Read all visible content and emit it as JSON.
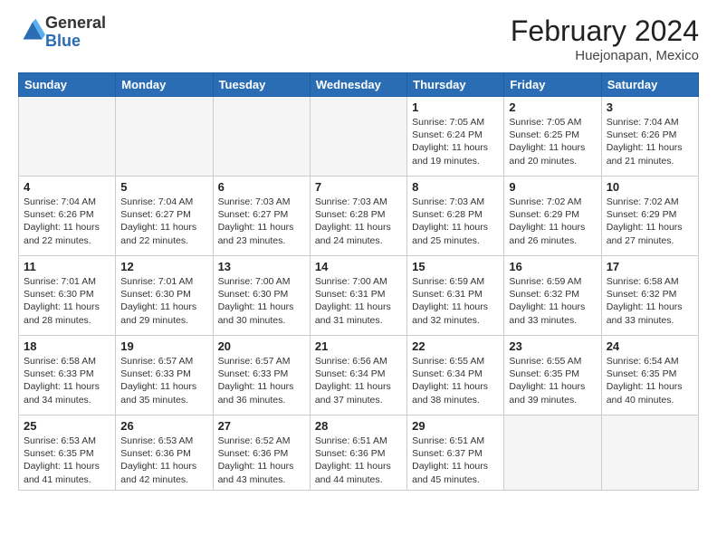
{
  "logo": {
    "general": "General",
    "blue": "Blue"
  },
  "header": {
    "month_year": "February 2024",
    "location": "Huejonapan, Mexico"
  },
  "weekdays": [
    "Sunday",
    "Monday",
    "Tuesday",
    "Wednesday",
    "Thursday",
    "Friday",
    "Saturday"
  ],
  "weeks": [
    [
      {
        "day": "",
        "info": ""
      },
      {
        "day": "",
        "info": ""
      },
      {
        "day": "",
        "info": ""
      },
      {
        "day": "",
        "info": ""
      },
      {
        "day": "1",
        "info": "Sunrise: 7:05 AM\nSunset: 6:24 PM\nDaylight: 11 hours and 19 minutes."
      },
      {
        "day": "2",
        "info": "Sunrise: 7:05 AM\nSunset: 6:25 PM\nDaylight: 11 hours and 20 minutes."
      },
      {
        "day": "3",
        "info": "Sunrise: 7:04 AM\nSunset: 6:26 PM\nDaylight: 11 hours and 21 minutes."
      }
    ],
    [
      {
        "day": "4",
        "info": "Sunrise: 7:04 AM\nSunset: 6:26 PM\nDaylight: 11 hours and 22 minutes."
      },
      {
        "day": "5",
        "info": "Sunrise: 7:04 AM\nSunset: 6:27 PM\nDaylight: 11 hours and 22 minutes."
      },
      {
        "day": "6",
        "info": "Sunrise: 7:03 AM\nSunset: 6:27 PM\nDaylight: 11 hours and 23 minutes."
      },
      {
        "day": "7",
        "info": "Sunrise: 7:03 AM\nSunset: 6:28 PM\nDaylight: 11 hours and 24 minutes."
      },
      {
        "day": "8",
        "info": "Sunrise: 7:03 AM\nSunset: 6:28 PM\nDaylight: 11 hours and 25 minutes."
      },
      {
        "day": "9",
        "info": "Sunrise: 7:02 AM\nSunset: 6:29 PM\nDaylight: 11 hours and 26 minutes."
      },
      {
        "day": "10",
        "info": "Sunrise: 7:02 AM\nSunset: 6:29 PM\nDaylight: 11 hours and 27 minutes."
      }
    ],
    [
      {
        "day": "11",
        "info": "Sunrise: 7:01 AM\nSunset: 6:30 PM\nDaylight: 11 hours and 28 minutes."
      },
      {
        "day": "12",
        "info": "Sunrise: 7:01 AM\nSunset: 6:30 PM\nDaylight: 11 hours and 29 minutes."
      },
      {
        "day": "13",
        "info": "Sunrise: 7:00 AM\nSunset: 6:30 PM\nDaylight: 11 hours and 30 minutes."
      },
      {
        "day": "14",
        "info": "Sunrise: 7:00 AM\nSunset: 6:31 PM\nDaylight: 11 hours and 31 minutes."
      },
      {
        "day": "15",
        "info": "Sunrise: 6:59 AM\nSunset: 6:31 PM\nDaylight: 11 hours and 32 minutes."
      },
      {
        "day": "16",
        "info": "Sunrise: 6:59 AM\nSunset: 6:32 PM\nDaylight: 11 hours and 33 minutes."
      },
      {
        "day": "17",
        "info": "Sunrise: 6:58 AM\nSunset: 6:32 PM\nDaylight: 11 hours and 33 minutes."
      }
    ],
    [
      {
        "day": "18",
        "info": "Sunrise: 6:58 AM\nSunset: 6:33 PM\nDaylight: 11 hours and 34 minutes."
      },
      {
        "day": "19",
        "info": "Sunrise: 6:57 AM\nSunset: 6:33 PM\nDaylight: 11 hours and 35 minutes."
      },
      {
        "day": "20",
        "info": "Sunrise: 6:57 AM\nSunset: 6:33 PM\nDaylight: 11 hours and 36 minutes."
      },
      {
        "day": "21",
        "info": "Sunrise: 6:56 AM\nSunset: 6:34 PM\nDaylight: 11 hours and 37 minutes."
      },
      {
        "day": "22",
        "info": "Sunrise: 6:55 AM\nSunset: 6:34 PM\nDaylight: 11 hours and 38 minutes."
      },
      {
        "day": "23",
        "info": "Sunrise: 6:55 AM\nSunset: 6:35 PM\nDaylight: 11 hours and 39 minutes."
      },
      {
        "day": "24",
        "info": "Sunrise: 6:54 AM\nSunset: 6:35 PM\nDaylight: 11 hours and 40 minutes."
      }
    ],
    [
      {
        "day": "25",
        "info": "Sunrise: 6:53 AM\nSunset: 6:35 PM\nDaylight: 11 hours and 41 minutes."
      },
      {
        "day": "26",
        "info": "Sunrise: 6:53 AM\nSunset: 6:36 PM\nDaylight: 11 hours and 42 minutes."
      },
      {
        "day": "27",
        "info": "Sunrise: 6:52 AM\nSunset: 6:36 PM\nDaylight: 11 hours and 43 minutes."
      },
      {
        "day": "28",
        "info": "Sunrise: 6:51 AM\nSunset: 6:36 PM\nDaylight: 11 hours and 44 minutes."
      },
      {
        "day": "29",
        "info": "Sunrise: 6:51 AM\nSunset: 6:37 PM\nDaylight: 11 hours and 45 minutes."
      },
      {
        "day": "",
        "info": ""
      },
      {
        "day": "",
        "info": ""
      }
    ]
  ]
}
